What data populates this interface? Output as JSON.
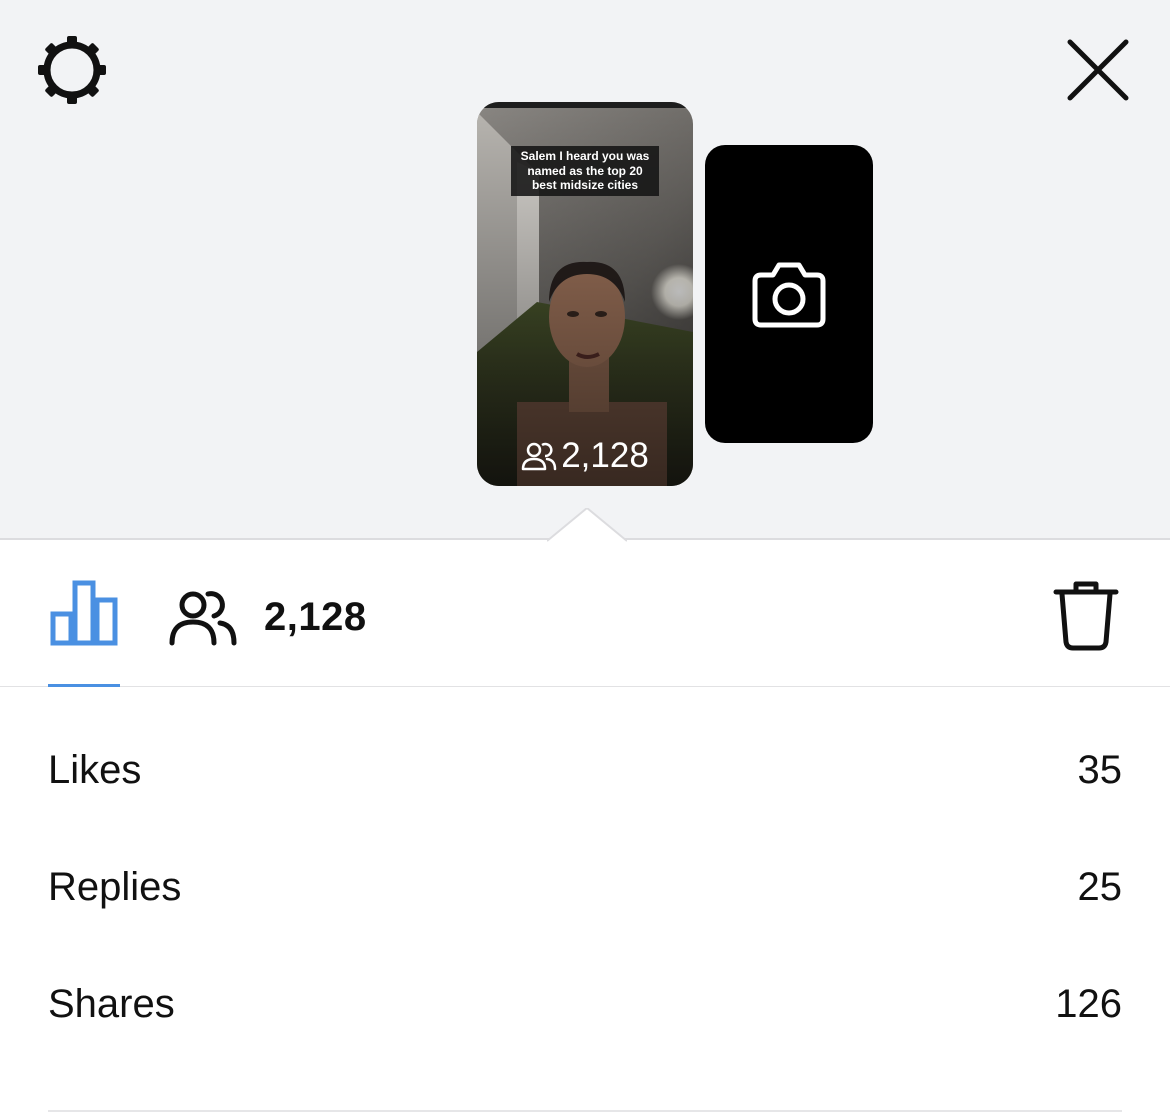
{
  "header": {
    "settings_icon": "gear-icon",
    "close_icon": "close-icon"
  },
  "story": {
    "caption": "Salem I heard you was named as the top 20 best midsize cities",
    "viewer_count": "2,128",
    "viewers_icon": "people-icon"
  },
  "add_story": {
    "icon": "camera-icon"
  },
  "tabs": {
    "insights_icon": "bar-chart-icon",
    "viewers_icon": "people-icon",
    "viewer_count": "2,128",
    "delete_icon": "trash-icon",
    "accent_color": "#4a90e2"
  },
  "stats": [
    {
      "label": "Likes",
      "value": "35"
    },
    {
      "label": "Replies",
      "value": "25"
    },
    {
      "label": "Shares",
      "value": "126"
    }
  ]
}
